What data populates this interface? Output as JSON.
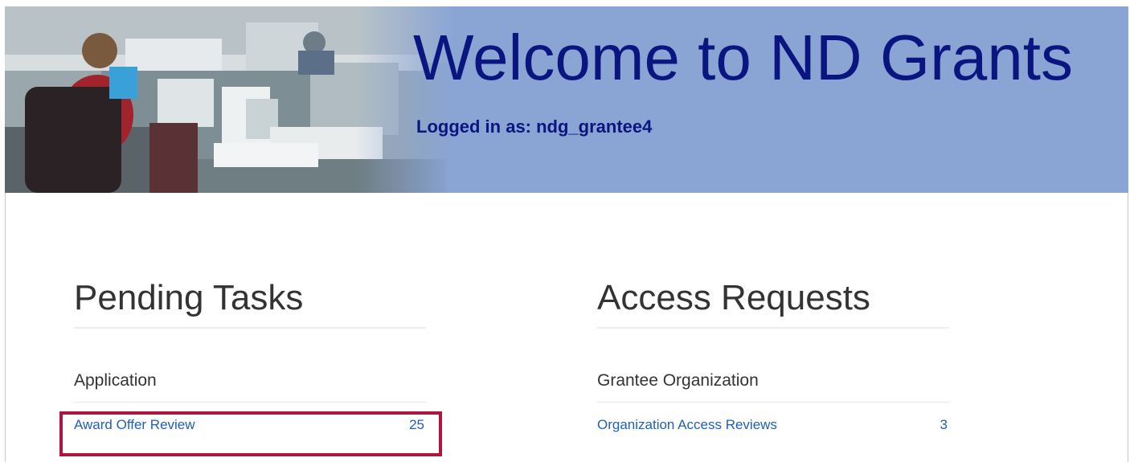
{
  "banner": {
    "title": "Welcome to ND Grants",
    "logged_in_text": "Logged in as: ndg_grantee4"
  },
  "pending_tasks": {
    "heading": "Pending Tasks",
    "category": "Application",
    "items": [
      {
        "label": "Award Offer Review",
        "count": "25"
      }
    ]
  },
  "access_requests": {
    "heading": "Access Requests",
    "category": "Grantee Organization",
    "items": [
      {
        "label": "Organization Access Reviews",
        "count": "3"
      }
    ]
  },
  "colors": {
    "banner_bg": "#8aa4d4",
    "title_text": "#0a1580",
    "link": "#1f5fb8",
    "highlight_border": "#b0153f"
  }
}
